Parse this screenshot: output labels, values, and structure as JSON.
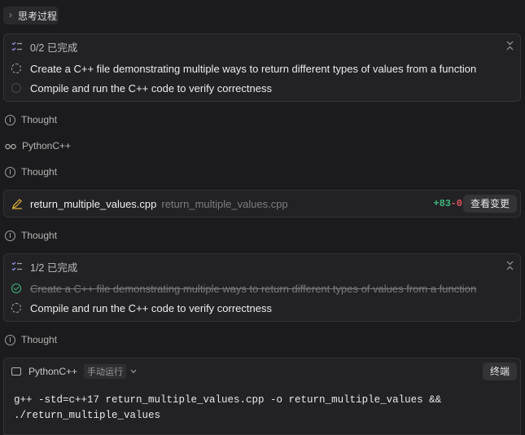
{
  "thinking_toggle": {
    "label": "思考过程",
    "chevron": "›"
  },
  "todo_card_1": {
    "progress": "0/2 已完成",
    "tasks": [
      {
        "label": "Create a C++ file demonstrating multiple ways to return different types of values from a function",
        "status": "in-progress"
      },
      {
        "label": "Compile and run the C++ code to verify correctness",
        "status": "pending"
      }
    ]
  },
  "thought_label": "Thought",
  "tool_python": {
    "label": "PythonC++",
    "icon": "glasses-icon"
  },
  "file_card": {
    "file_name": "return_multiple_values.cpp",
    "file_path": "return_multiple_values.cpp",
    "added": "+83",
    "removed": "-0",
    "view_changes": "查看变更"
  },
  "todo_card_2": {
    "progress": "1/2 已完成",
    "tasks": [
      {
        "label": "Create a C++ file demonstrating multiple ways to return different types of values from a function",
        "status": "done"
      },
      {
        "label": "Compile and run the C++ code to verify correctness",
        "status": "in-progress"
      }
    ]
  },
  "terminal_card": {
    "title": "PythonC++",
    "mode_tag": "手动运行",
    "terminal_button": "终端",
    "command_line_1": "g++ -std=c++17 return_multiple_values.cpp -o return_multiple_values &&",
    "command_line_2": "./return_multiple_values"
  },
  "colors": {
    "background": "#1b1b1d",
    "added": "#3fb67a",
    "removed": "#e0565b",
    "done": "#3fb67a",
    "pen": "#e2b23a"
  }
}
